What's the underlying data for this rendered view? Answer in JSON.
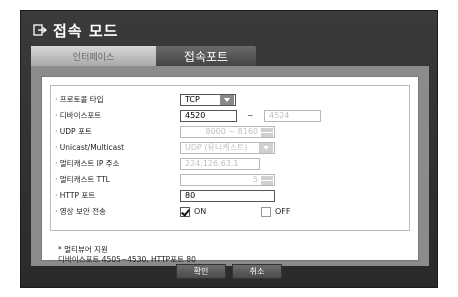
{
  "header": {
    "title": "접속 모드",
    "icon": "exit-icon"
  },
  "tabs": [
    {
      "label": "인터페이스"
    },
    {
      "label": "접속포트"
    }
  ],
  "form": {
    "protocol": {
      "label": "· 프로토콜 타입",
      "value": "TCP"
    },
    "device_port": {
      "label": "· 디바이스포트",
      "value": "4520",
      "dash": "~",
      "end_value": "4524"
    },
    "udp_port": {
      "label": "· UDP 포트",
      "value": "8000 ~ 8160"
    },
    "unicast": {
      "label": "· Unicast/Multicast",
      "value": "UDP (유니캐스트)"
    },
    "multicast_ip": {
      "label": "· 멀티캐스트 IP 주소",
      "value": "224.126.63.1"
    },
    "multicast_ttl": {
      "label": "· 멀티캐스트 TTL",
      "value": "5"
    },
    "http_port": {
      "label": "· HTTP 포트",
      "value": "80"
    },
    "secure": {
      "label": "· 영상 보안 전송",
      "on_label": "ON",
      "off_label": "OFF"
    }
  },
  "note": {
    "line1": "* 멀티뷰어 지원",
    "line2": "디바이스포트 4505~4530, HTTP포트 80"
  },
  "buttons": {
    "ok": "확인",
    "cancel": "취소"
  }
}
